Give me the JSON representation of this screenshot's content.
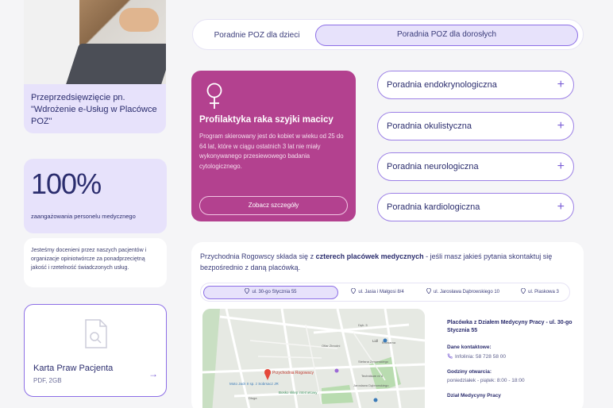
{
  "project": {
    "title": "Przeprzedsięwzięcie pn. \"Wdrożenie e-Usług w Placówce POZ\""
  },
  "stat": {
    "value": "100%",
    "label": "zaangażowania personelu medycznego"
  },
  "note": {
    "text": "Jesteśmy docenieni przez naszych pacjentów i organizacje opiniotwórcze za ponadprzeciętną jakość i rzetelność świadczonych usług."
  },
  "document": {
    "title": "Karta Praw Pacjenta",
    "meta": "PDF, 2GB",
    "icon": "document-search-icon"
  },
  "tabs": {
    "items": [
      {
        "label": "Poradnie POZ dla dzieci",
        "active": false
      },
      {
        "label": "Poradnia POZ dla dorosłych",
        "active": true
      }
    ]
  },
  "feature": {
    "icon": "venus-icon",
    "title": "Profilaktyka raka szyjki macicy",
    "description": "Program skierowany jest do kobiet w wieku od 25 do 64 lat, które w ciągu ostatnich 3 lat nie miały wykonywanego przesiewowego badania cytologicznego.",
    "button": "Zobacz szczegóły",
    "color": "#b3418f"
  },
  "clinics": {
    "items": [
      {
        "label": "Poradnia endokrynologiczna"
      },
      {
        "label": "Poradnia okulistyczna"
      },
      {
        "label": "Poradnia neurologiczna"
      },
      {
        "label": "Poradnia kardiologiczna"
      }
    ]
  },
  "locations": {
    "intro_pre": "Przychodnia Rogowscy składa się z ",
    "intro_bold": "czterech placówek medycznych",
    "intro_post": " - jeśli masz jakieś pytania skontaktuj się bezpośrednio z daną placówką.",
    "tabs": [
      {
        "label": "ul. 30-go Stycznia 55",
        "active": true
      },
      {
        "label": "ul. Jasia i Małgosi 8/4",
        "active": false
      },
      {
        "label": "ul. Jarosława Dąbrowskiego 10",
        "active": false
      },
      {
        "label": "ul. Piaskowa 3",
        "active": false
      }
    ],
    "map": {
      "marker_label": "Przychodnia Rogowscy",
      "places": [
        "Moto Jack II sp. z Sobrsacz JR",
        "Bosko sklep internetowy",
        "Lidl",
        "Technikum nr 4",
        "Jarosława Dąbrowskiego",
        "Ofiar Zbrodni",
        "Dęb. 5",
        "Browarna",
        "Stefana Żeromskiego",
        "Długa"
      ]
    },
    "info": {
      "title": "Placówka z Działem Medycyny Pracy - ul. 30-go Stycznia 55",
      "contact_label": "Dane kontaktowe:",
      "phone": "Infolinia: 58 728 58 00",
      "hours_label": "Godziny otwarcia:",
      "hours": "poniedziałek - piątek: 8:00 - 18:00",
      "extra_label": "Dział Medycyny Pracy"
    }
  },
  "colors": {
    "accent": "#8c6ee6",
    "light_purple": "#e7e2fb",
    "navy": "#2b2d6e",
    "magenta": "#b3418f"
  }
}
